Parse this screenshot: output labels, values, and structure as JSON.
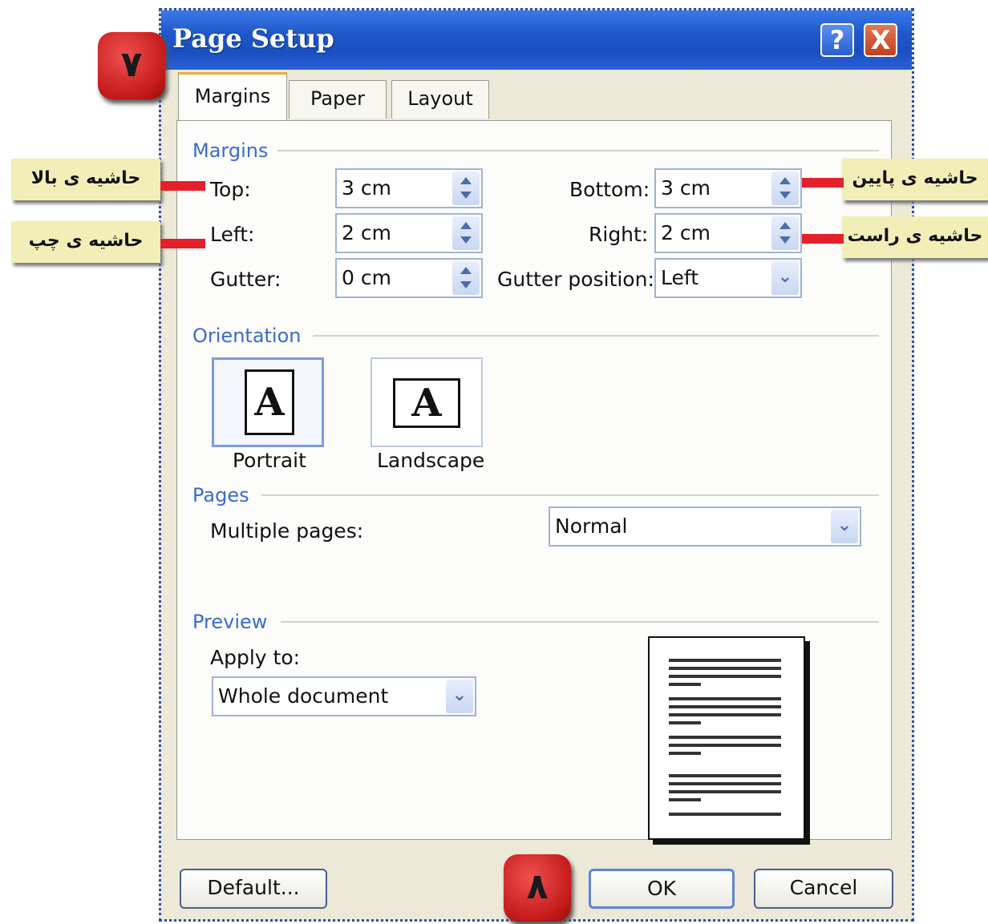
{
  "window": {
    "title": "Page Setup",
    "help_label": "?",
    "close_label": "X"
  },
  "tabs": [
    {
      "label": "Margins",
      "active": true
    },
    {
      "label": "Paper",
      "active": false
    },
    {
      "label": "Layout",
      "active": false
    }
  ],
  "margins": {
    "section_title": "Margins",
    "top_label": "Top:",
    "top_value": "3 cm",
    "bottom_label": "Bottom:",
    "bottom_value": "3 cm",
    "left_label": "Left:",
    "left_value": "2 cm",
    "right_label": "Right:",
    "right_value": "2 cm",
    "gutter_label": "Gutter:",
    "gutter_value": "0 cm",
    "gutter_position_label": "Gutter position:",
    "gutter_position_value": "Left"
  },
  "orientation": {
    "section_title": "Orientation",
    "portrait_label": "Portrait",
    "landscape_label": "Landscape",
    "icon_letter": "A",
    "selected": "Portrait"
  },
  "pages": {
    "section_title": "Pages",
    "multiple_pages_label": "Multiple pages:",
    "multiple_pages_value": "Normal"
  },
  "preview": {
    "section_title": "Preview",
    "apply_to_label": "Apply to:",
    "apply_to_value": "Whole document"
  },
  "buttons": {
    "default_label": "Default...",
    "ok_label": "OK",
    "cancel_label": "Cancel"
  },
  "annotations": {
    "top_margin": "حاشیه ی بالا",
    "left_margin": "حاشیه ی چپ",
    "bottom_margin": "حاشیه ی پایین",
    "right_margin": "حاشیه ی راست",
    "step_7": "۷",
    "step_8": "۸"
  },
  "colors": {
    "title_bar": "#1f57c9",
    "section_title": "#3a6bd0",
    "badge_red": "#d42a2a",
    "callout_bg": "#f1eeb8",
    "marker_red": "#e4212b",
    "active_tab_accent": "#f2a93b"
  }
}
